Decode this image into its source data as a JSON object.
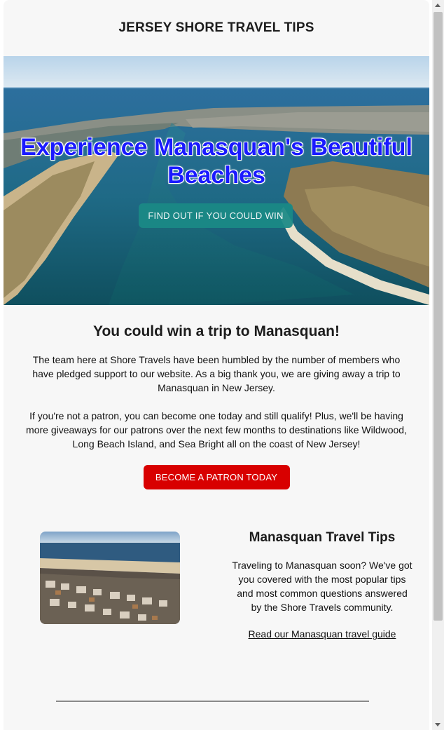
{
  "header": {
    "title": "JERSEY SHORE TRAVEL TIPS"
  },
  "hero": {
    "heading": "Experience Manasquan's Beautiful Beaches",
    "cta_label": "FIND OUT IF YOU COULD WIN"
  },
  "contest": {
    "title": "You could win a trip to Manasquan!",
    "paragraph1": "The team here at Shore Travels have been humbled by the number of members who have pledged support to our website. As a big thank you, we are giving away a trip to Manasquan in New Jersey.",
    "paragraph2": "If you're not a patron, you can become one today and still qualify! Plus, we'll be having more giveaways for our patrons over the next few months to destinations like Wildwood, Long Beach Island, and Sea Bright all on the coast of New Jersey!",
    "button_label": "BECOME A PATRON TODAY"
  },
  "tips": {
    "title": "Manasquan Travel Tips",
    "body": "Traveling to Manasquan soon? We've got you covered with the most popular tips and most common questions answered by the Shore Travels community.",
    "link_label": "Read our Manasquan travel guide"
  },
  "colors": {
    "hero_heading": "#1a1aff",
    "hero_button": "#1a8a86",
    "patron_button": "#d80000",
    "page_background": "#f7f7f7"
  }
}
